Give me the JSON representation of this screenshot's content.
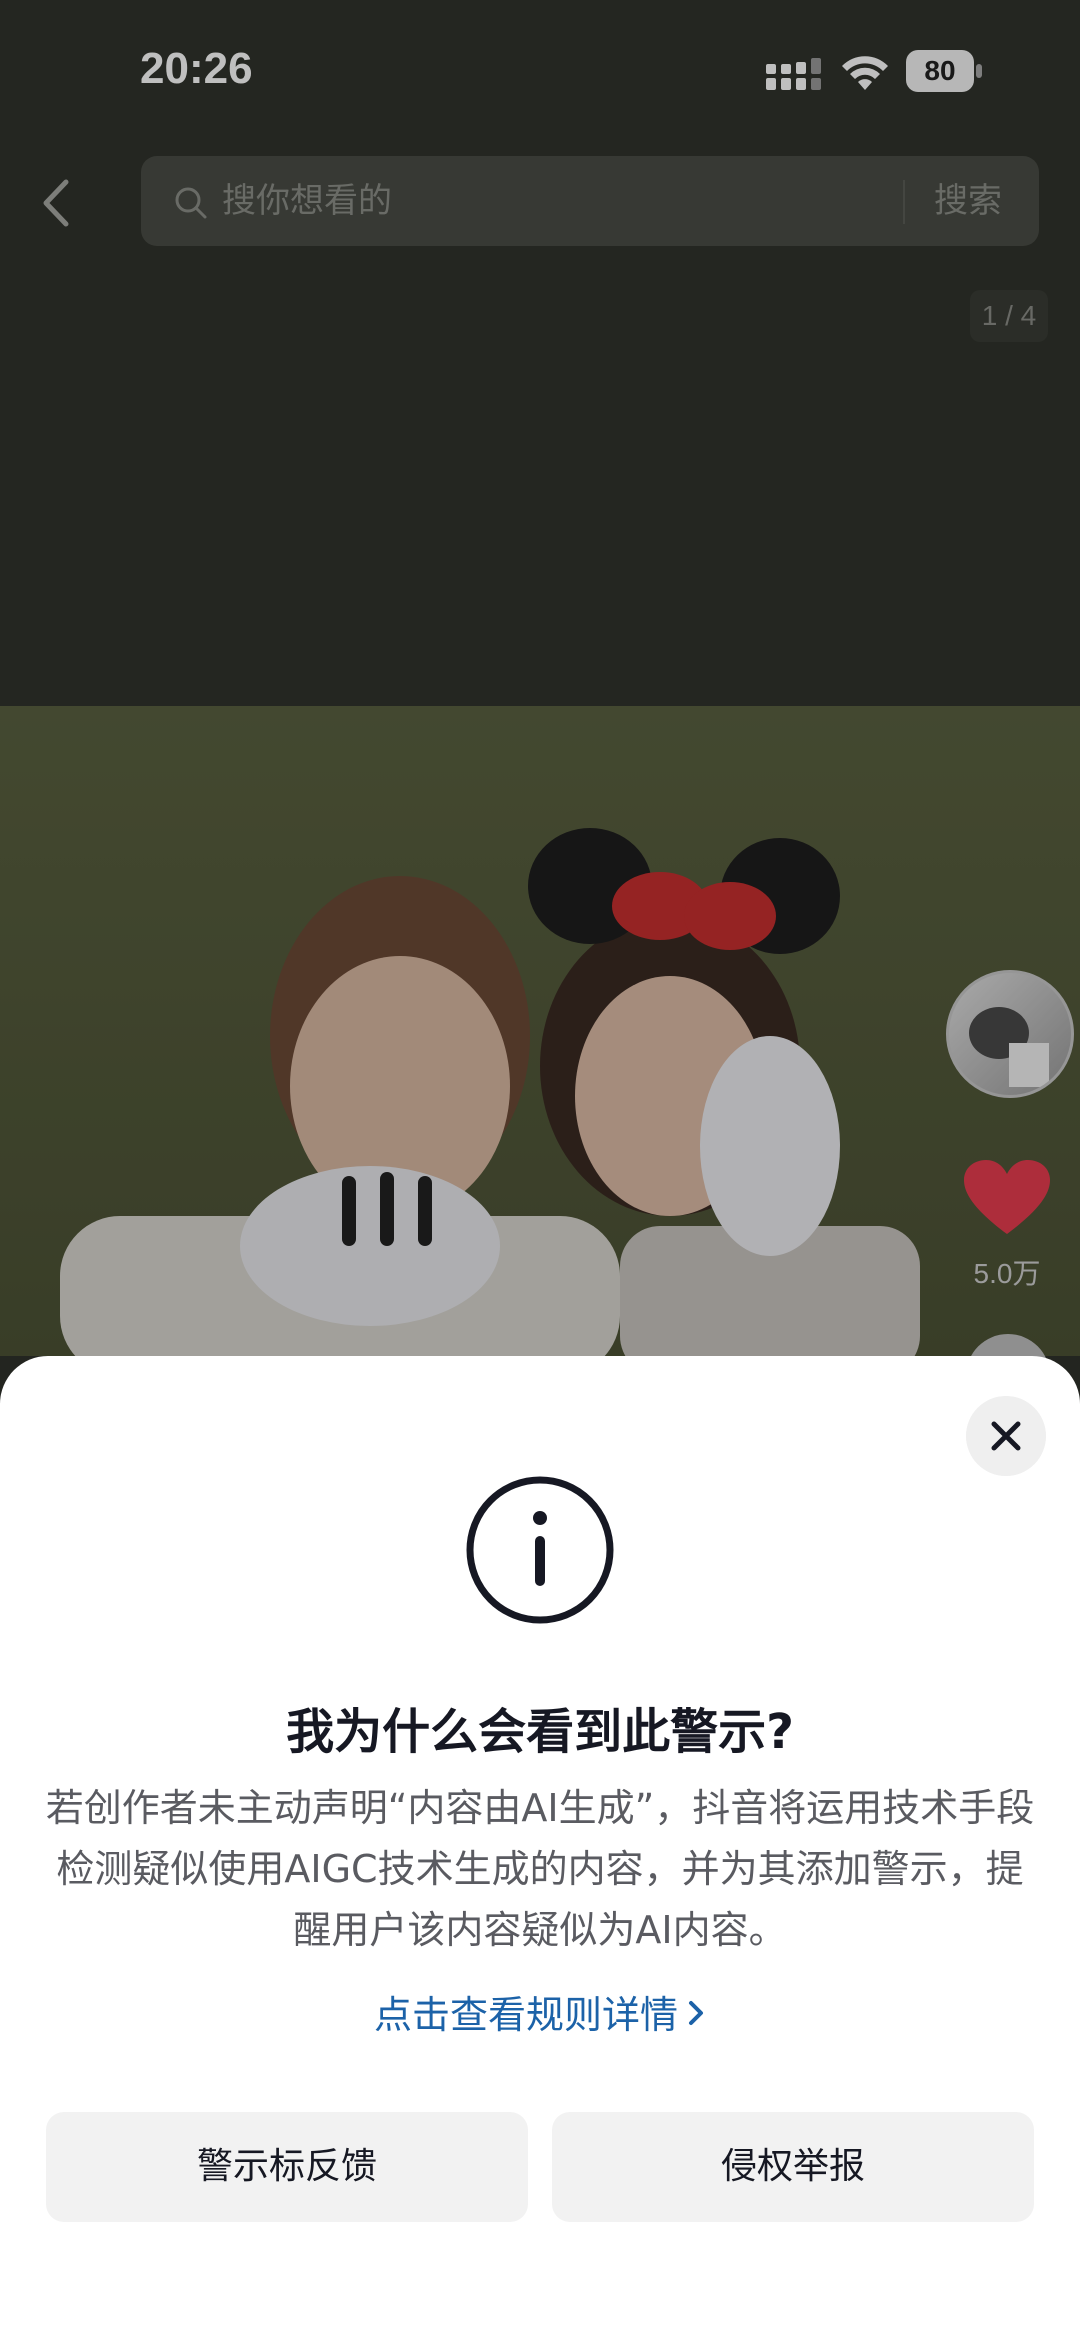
{
  "status_bar": {
    "time": "20:26",
    "battery_level": "80"
  },
  "search": {
    "placeholder": "搜你想看的",
    "button_label": "搜索"
  },
  "gallery": {
    "page_indicator": "1 / 4"
  },
  "side_actions": {
    "like_count": "5.0万"
  },
  "sheet": {
    "title": "我为什么会看到此警示?",
    "body": "若创作者未主动声明“内容由AI生成”，抖音将运用技术手段检测疑似使用AIGC技术生成的内容，并为其添加警示，提醒用户该内容疑似为AI内容。",
    "rules_link": "点击查看规则详情",
    "feedback_button": "警示标反馈",
    "report_button": "侵权举报"
  },
  "colors": {
    "link": "#1c62a8",
    "like": "#e73c4f",
    "title": "#161823"
  }
}
